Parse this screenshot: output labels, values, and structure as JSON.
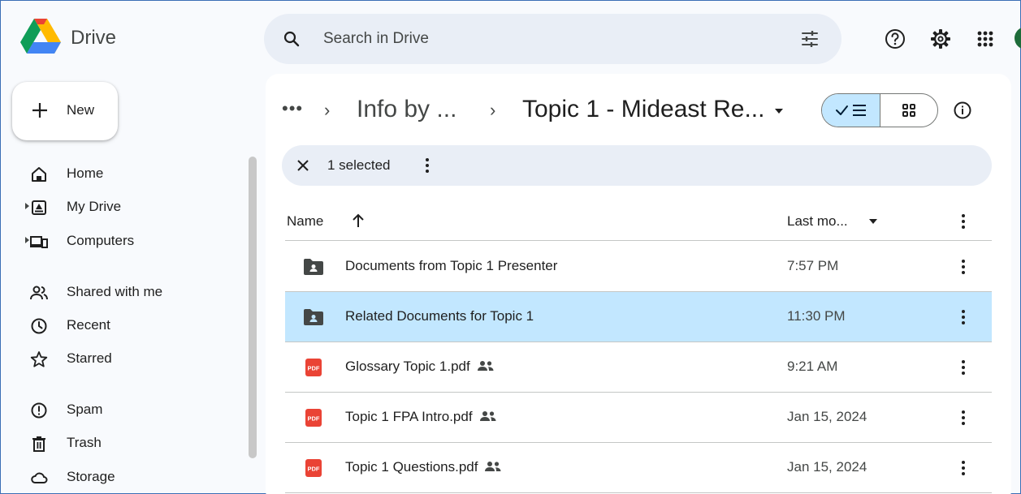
{
  "app": {
    "name": "Drive"
  },
  "search": {
    "placeholder": "Search in Drive"
  },
  "sidebar": {
    "new_label": "New",
    "items": [
      {
        "label": "Home",
        "icon": "home-icon"
      },
      {
        "label": "My Drive",
        "icon": "my-drive-icon"
      },
      {
        "label": "Computers",
        "icon": "computers-icon"
      },
      {
        "label": "Shared with me",
        "icon": "shared-with-me-icon"
      },
      {
        "label": "Recent",
        "icon": "recent-clock-icon"
      },
      {
        "label": "Starred",
        "icon": "star-icon"
      },
      {
        "label": "Spam",
        "icon": "spam-icon"
      },
      {
        "label": "Trash",
        "icon": "trash-icon"
      },
      {
        "label": "Storage",
        "icon": "cloud-storage-icon"
      }
    ]
  },
  "breadcrumb": {
    "more": "•••",
    "sep": "›",
    "parent": "Info by ...",
    "current": "Topic 1 - Mideast Re..."
  },
  "selection": {
    "text": "1 selected"
  },
  "table": {
    "header": {
      "name": "Name",
      "modified": "Last mo..."
    },
    "rows": [
      {
        "name": "Documents from Topic 1 Presenter",
        "date": "7:57 PM",
        "type": "shared-folder",
        "shared": false,
        "selected": false
      },
      {
        "name": "Related Documents for Topic 1",
        "date": "11:30 PM",
        "type": "shared-folder",
        "shared": false,
        "selected": true
      },
      {
        "name": "Glossary Topic 1.pdf",
        "date": "9:21 AM",
        "type": "pdf",
        "shared": true,
        "selected": false
      },
      {
        "name": "Topic 1 FPA Intro.pdf",
        "date": "Jan 15, 2024",
        "type": "pdf",
        "shared": true,
        "selected": false
      },
      {
        "name": "Topic 1 Questions.pdf",
        "date": "Jan 15, 2024",
        "type": "pdf",
        "shared": true,
        "selected": false
      }
    ]
  },
  "colors": {
    "selected_row": "#c2e7ff",
    "search_bg": "#e9eef6",
    "pdf_red": "#ea4335",
    "folder_gray": "#444746"
  }
}
